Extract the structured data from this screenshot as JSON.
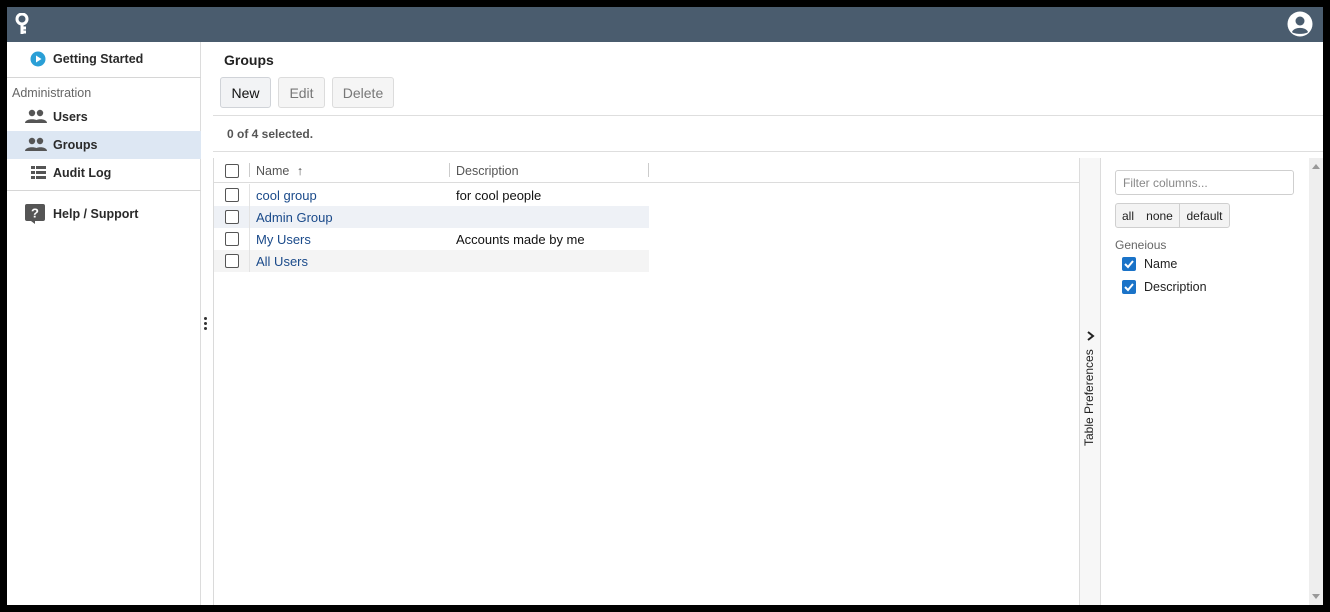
{
  "sidebar": {
    "getting_started": "Getting Started",
    "section_admin": "Administration",
    "users": "Users",
    "groups": "Groups",
    "audit_log": "Audit Log",
    "help": "Help / Support"
  },
  "main": {
    "title": "Groups",
    "buttons": {
      "new": "New",
      "edit": "Edit",
      "delete": "Delete"
    },
    "selected_count": "0 of 4 selected."
  },
  "table": {
    "columns": {
      "name": "Name",
      "description": "Description"
    },
    "sort_indicator": "↑",
    "rows": [
      {
        "name": "cool group",
        "description": "for cool people"
      },
      {
        "name": "Admin Group",
        "description": ""
      },
      {
        "name": "My Users",
        "description": "Accounts made by me"
      },
      {
        "name": "All Users",
        "description": ""
      }
    ]
  },
  "preferences": {
    "tab_label": "Table Preferences",
    "filter_placeholder": "Filter columns...",
    "buttons": {
      "all": "all",
      "none": "none",
      "default": "default"
    },
    "group_label": "Geneious",
    "columns": [
      {
        "label": "Name",
        "checked": true
      },
      {
        "label": "Description",
        "checked": true
      }
    ]
  },
  "colors": {
    "topbar": "#4a5c6e",
    "link": "#1a4a8a",
    "accent": "#1a73c8",
    "active_nav": "#dde7f3"
  }
}
